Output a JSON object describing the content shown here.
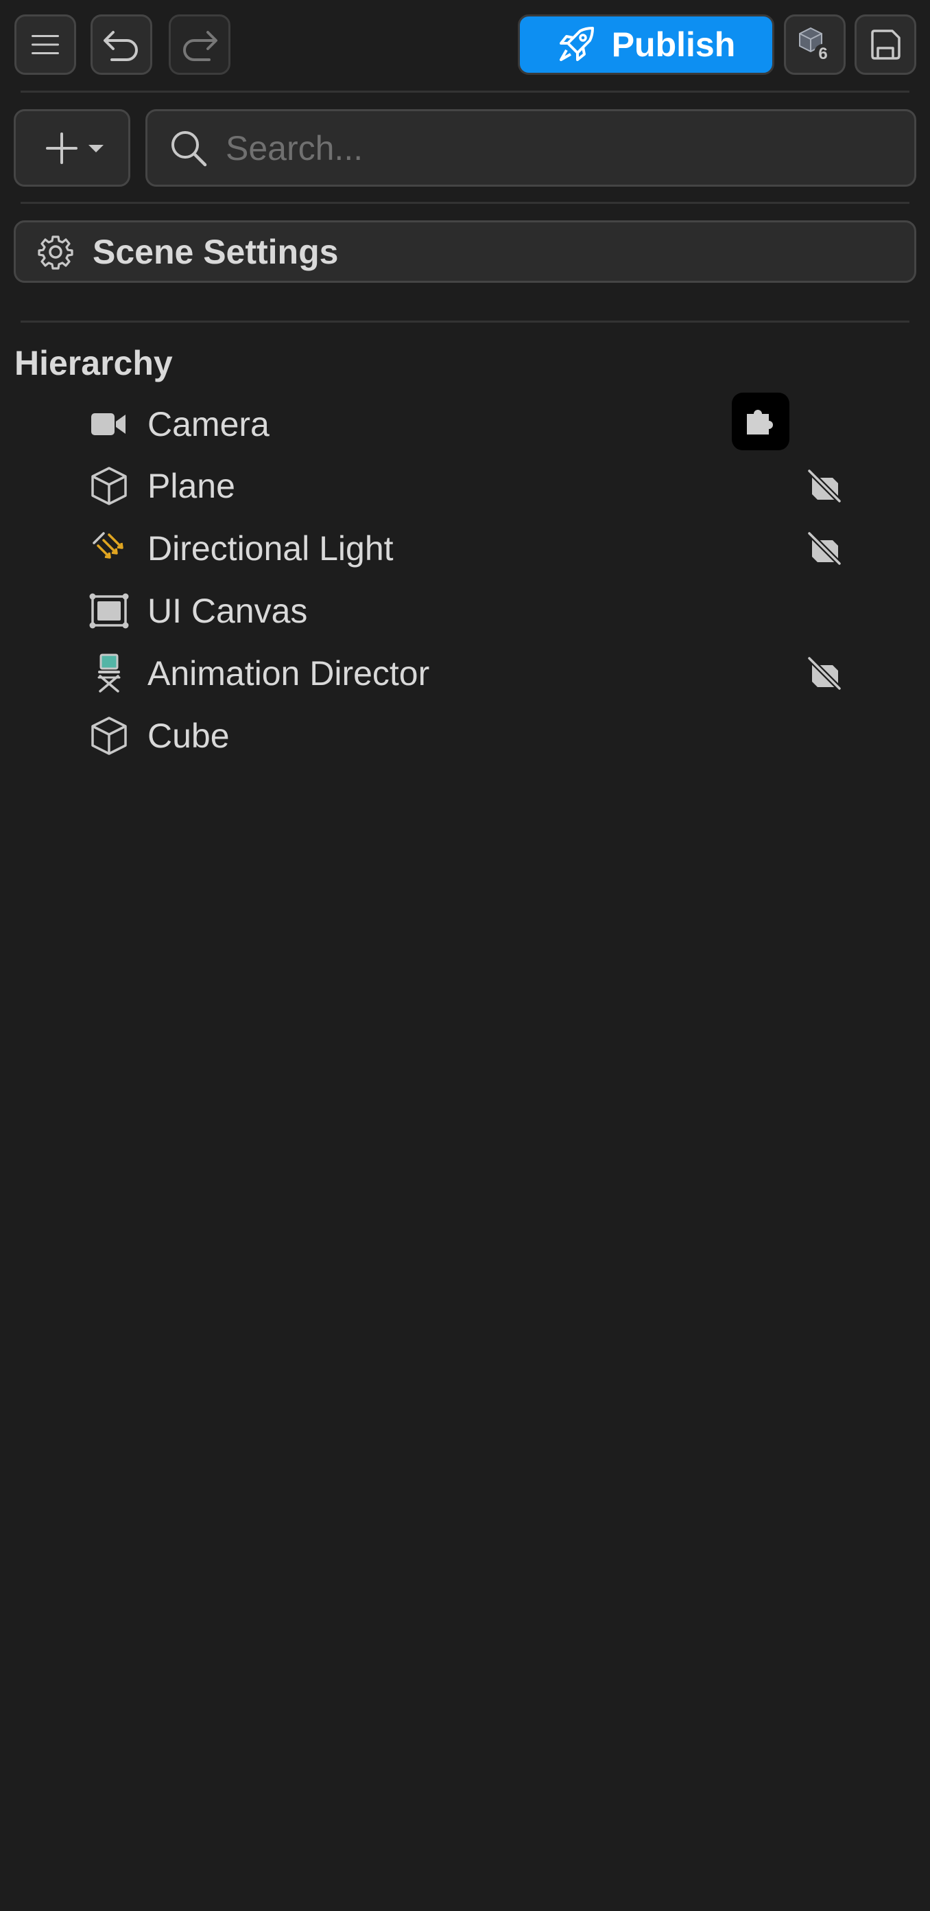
{
  "toolbar": {
    "menu_icon": "hamburger-menu-icon",
    "undo_icon": "undo-arrow-icon",
    "redo_icon": "redo-arrow-icon",
    "publish_label": "Publish",
    "publish_color": "#0d8ff2",
    "version_badge_icon": "cube-version-icon",
    "save_icon": "floppy-save-icon"
  },
  "search": {
    "add_icon": "plus-dropdown-icon",
    "placeholder": "Search..."
  },
  "scene_settings": {
    "label": "Scene Settings",
    "icon": "gear-icon"
  },
  "hierarchy": {
    "title": "Hierarchy",
    "items": [
      {
        "label": "Camera",
        "icon": "camera-icon",
        "right_icon": "puzzle-icon"
      },
      {
        "label": "Plane",
        "icon": "cube-icon",
        "right_icon": "visibility-off-icon"
      },
      {
        "label": "Directional Light",
        "icon": "directional-light-icon",
        "right_icon": "visibility-off-icon"
      },
      {
        "label": "UI Canvas",
        "icon": "canvas-frame-icon",
        "right_icon": ""
      },
      {
        "label": "Animation Director",
        "icon": "director-chair-icon",
        "right_icon": "visibility-off-icon"
      },
      {
        "label": "Cube",
        "icon": "cube-icon",
        "right_icon": ""
      }
    ]
  }
}
